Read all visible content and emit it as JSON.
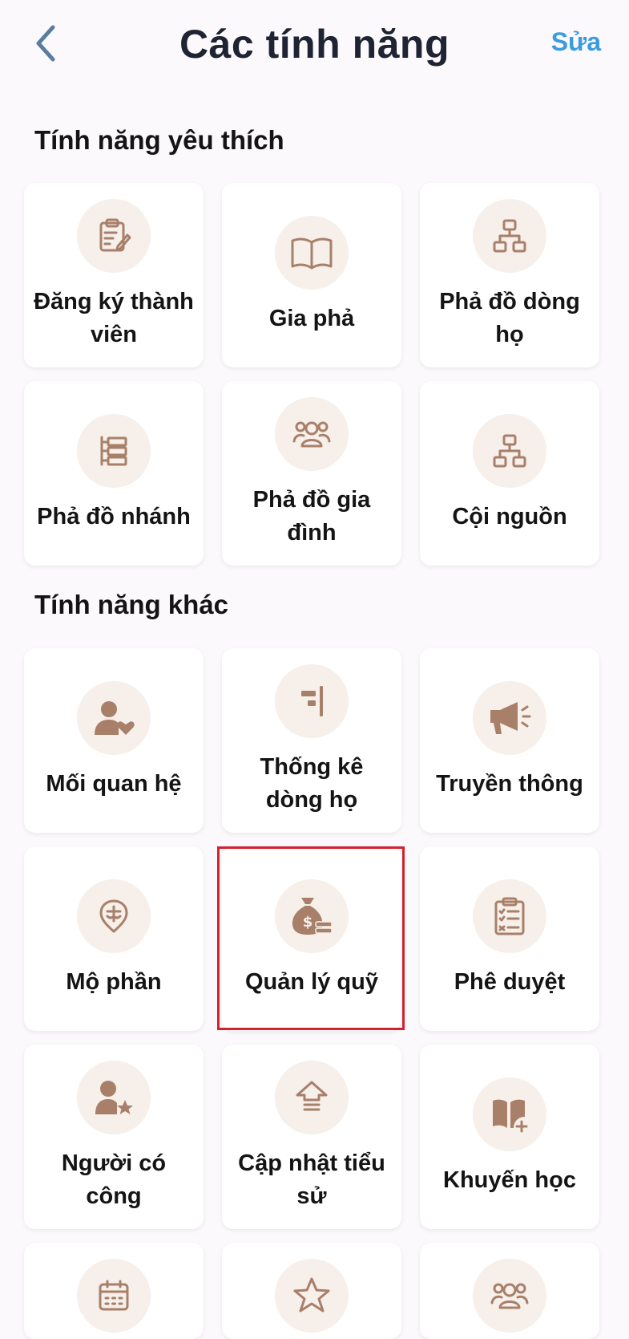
{
  "header": {
    "title": "Các tính năng",
    "edit_label": "Sửa"
  },
  "favorites": {
    "title": "Tính năng yêu thích",
    "items": [
      {
        "label": "Đăng ký thành viên",
        "icon": "clipboard-edit-icon"
      },
      {
        "label": "Gia phả",
        "icon": "open-book-icon"
      },
      {
        "label": "Phả đồ dòng họ",
        "icon": "hierarchy-icon"
      },
      {
        "label": "Phả đồ nhánh",
        "icon": "branch-list-icon"
      },
      {
        "label": "Phả đồ gia đình",
        "icon": "family-group-icon"
      },
      {
        "label": "Cội nguồn",
        "icon": "hierarchy-icon"
      }
    ]
  },
  "others": {
    "title": "Tính năng khác",
    "items": [
      {
        "label": "Mối quan hệ",
        "icon": "user-heart-icon"
      },
      {
        "label": "Thống kê dòng họ",
        "icon": "statistics-icon"
      },
      {
        "label": "Truyền thông",
        "icon": "megaphone-icon"
      },
      {
        "label": "Mộ phần",
        "icon": "grave-marker-icon"
      },
      {
        "label": "Quản lý quỹ",
        "icon": "money-bag-icon"
      },
      {
        "label": "Phê duyệt",
        "icon": "checklist-icon"
      },
      {
        "label": "Người có công",
        "icon": "user-star-icon"
      },
      {
        "label": "Cập nhật tiểu sử",
        "icon": "upload-arrow-icon"
      },
      {
        "label": "Khuyến học",
        "icon": "book-plus-icon"
      },
      {
        "label": "",
        "icon": "calendar-icon"
      },
      {
        "label": "",
        "icon": "star-icon"
      },
      {
        "label": "",
        "icon": "family-group-icon"
      }
    ]
  },
  "colors": {
    "accent": "#3a9ce0",
    "icon": "#a8806a",
    "icon_bg": "#f6efea",
    "highlight": "#d3212d"
  }
}
